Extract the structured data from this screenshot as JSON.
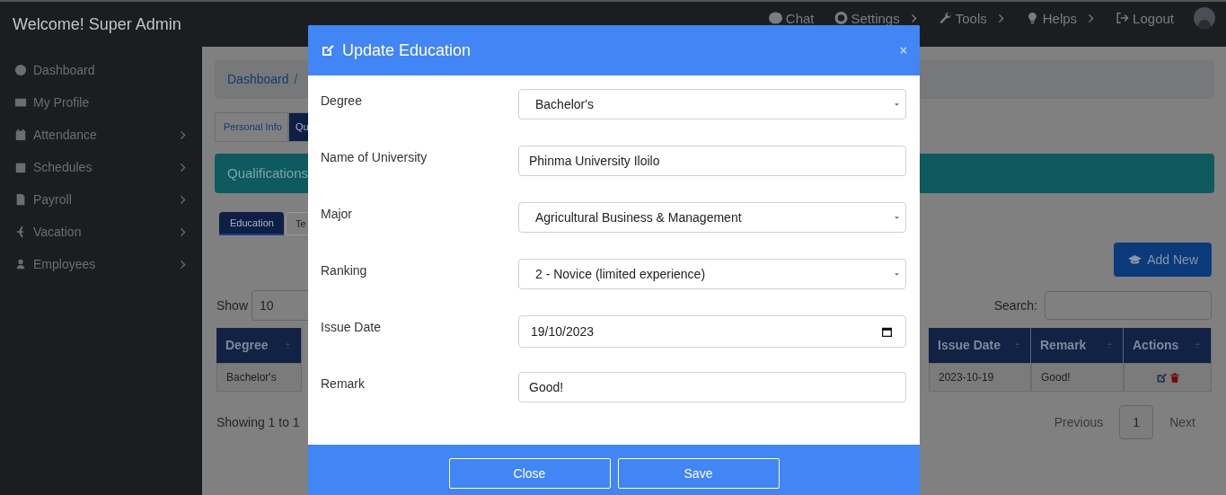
{
  "header": {
    "title": "Welcome! Super Admin",
    "menu": [
      {
        "label": "Chat",
        "submenu": false
      },
      {
        "label": "Settings",
        "submenu": true
      },
      {
        "label": "Tools",
        "submenu": true
      },
      {
        "label": "Helps",
        "submenu": true
      },
      {
        "label": "Logout",
        "submenu": false
      }
    ]
  },
  "sidebar": {
    "items": [
      {
        "label": "Dashboard",
        "submenu": false
      },
      {
        "label": "My Profile",
        "submenu": false
      },
      {
        "label": "Attendance",
        "submenu": true
      },
      {
        "label": "Schedules",
        "submenu": true
      },
      {
        "label": "Payroll",
        "submenu": true
      },
      {
        "label": "Vacation",
        "submenu": true
      },
      {
        "label": "Employees",
        "submenu": true
      }
    ]
  },
  "breadcrumb": [
    "Dashboard",
    "/"
  ],
  "tabs": [
    {
      "label": "Personal Info",
      "selected": false
    },
    {
      "label": "Qu",
      "selected": true
    }
  ],
  "section_title": "Qualifications",
  "subtabs": [
    {
      "label": "Education",
      "selected": true
    },
    {
      "label": "Te",
      "selected": false
    }
  ],
  "add_button": "Add New",
  "table": {
    "show_label": "Show",
    "page_size": "10",
    "search_label": "Search:",
    "columns": [
      {
        "label": "Degree"
      },
      {
        "label": "Issue Date"
      },
      {
        "label": "Remark"
      },
      {
        "label": "Actions"
      }
    ],
    "rows": [
      {
        "cells": [
          "Bachelor's",
          "2023-10-19",
          "Good!"
        ]
      }
    ],
    "info": "Showing 1 to 1",
    "pagination": {
      "previous": "Previous",
      "pages": [
        {
          "label": "1",
          "selected": true
        }
      ],
      "next": "Next"
    }
  },
  "modal": {
    "title": "Update Education",
    "close": "×",
    "fields": [
      {
        "label": "Degree",
        "kind": "select",
        "value": "Bachelor's"
      },
      {
        "label": "Name of University",
        "kind": "text",
        "value": "Phinma University Iloilo"
      },
      {
        "label": "Major",
        "kind": "select",
        "value": "Agricultural Business & Management"
      },
      {
        "label": "Ranking",
        "kind": "select",
        "value": "2 - Novice (limited experience)"
      },
      {
        "label": "Issue Date",
        "kind": "date",
        "value": "19/10/2023"
      },
      {
        "label": "Remark",
        "kind": "text",
        "value": "Good!"
      }
    ],
    "buttons": [
      "Close",
      "Save"
    ]
  }
}
